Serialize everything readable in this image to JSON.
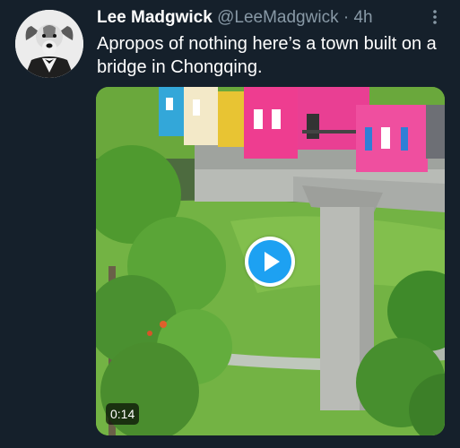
{
  "tweet": {
    "display_name": "Lee Madgwick",
    "handle": "@LeeMadgwick",
    "separator": "·",
    "time": "4h",
    "text": "Apropos of nothing here’s a town built on a bridge in Chongqing."
  },
  "video": {
    "duration": "0:14"
  },
  "icons": {
    "avatar": "dog-in-suit-avatar",
    "more": "more-vertical-icon",
    "play": "play-icon"
  },
  "colors": {
    "background": "#15202b",
    "secondary_text": "#8899a6",
    "accent": "#1da1f2"
  }
}
